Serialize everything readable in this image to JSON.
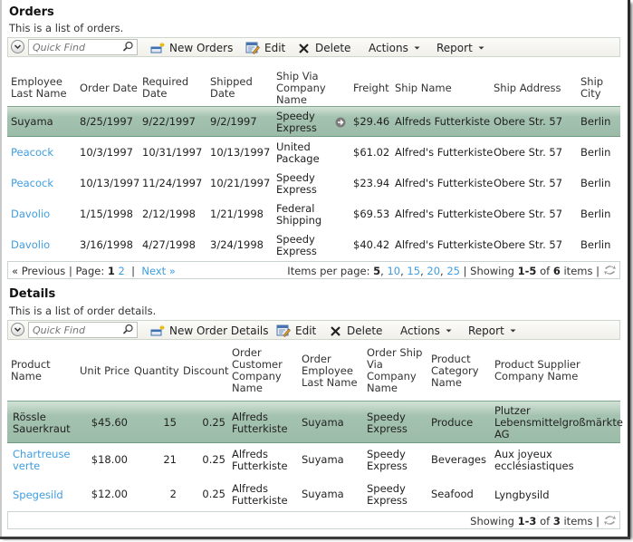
{
  "orders": {
    "title": "Orders",
    "description": "This is a list of orders.",
    "toolbar": {
      "quick_find_placeholder": "Quick Find",
      "new_label": "New Orders",
      "edit_label": "Edit",
      "delete_label": "Delete",
      "actions_label": "Actions",
      "report_label": "Report"
    },
    "columns": [
      [
        "Employee",
        "Last Name"
      ],
      [
        "Order Date"
      ],
      [
        "Required",
        "Date"
      ],
      [
        "Shipped",
        "Date"
      ],
      [
        "Ship Via",
        "Company",
        "Name"
      ],
      [
        "Freight"
      ],
      [
        "Ship Name"
      ],
      [
        "Ship Address"
      ],
      [
        "Ship",
        "City"
      ]
    ],
    "rows": [
      {
        "employee": "Suyama",
        "order_date": "8/25/1997",
        "required_date": "9/22/1997",
        "shipped_date": "9/2/1997",
        "ship_via": [
          "Speedy",
          "Express"
        ],
        "freight": "$29.46",
        "ship_name": "Alfreds Futterkiste",
        "ship_address": "Obere Str. 57",
        "ship_city": "Berlin",
        "selected": true
      },
      {
        "employee": "Peacock",
        "order_date": "10/3/1997",
        "required_date": "10/31/1997",
        "shipped_date": "10/13/1997",
        "ship_via": [
          "United",
          "Package"
        ],
        "freight": "$61.02",
        "ship_name": "Alfred's Futterkiste",
        "ship_address": "Obere Str. 57",
        "ship_city": "Berlin"
      },
      {
        "employee": "Peacock",
        "order_date": "10/13/1997",
        "required_date": "11/24/1997",
        "shipped_date": "10/21/1997",
        "ship_via": [
          "Speedy",
          "Express"
        ],
        "freight": "$23.94",
        "ship_name": "Alfred's Futterkiste",
        "ship_address": "Obere Str. 57",
        "ship_city": "Berlin"
      },
      {
        "employee": "Davolio",
        "order_date": "1/15/1998",
        "required_date": "2/12/1998",
        "shipped_date": "1/21/1998",
        "ship_via": [
          "Federal",
          "Shipping"
        ],
        "freight": "$69.53",
        "ship_name": "Alfred's Futterkiste",
        "ship_address": "Obere Str. 57",
        "ship_city": "Berlin"
      },
      {
        "employee": "Davolio",
        "order_date": "3/16/1998",
        "required_date": "4/27/1998",
        "shipped_date": "3/24/1998",
        "ship_via": [
          "Speedy",
          "Express"
        ],
        "freight": "$40.42",
        "ship_name": "Alfred's Futterkiste",
        "ship_address": "Obere Str. 57",
        "ship_city": "Berlin"
      }
    ],
    "pager": {
      "previous": "« Previous",
      "page_label": "| Page:",
      "current_page": "1",
      "other_page": "2",
      "separator": "|",
      "next": "Next »",
      "items_per_page_label": "Items per page:",
      "current_size": "5",
      "sizes": [
        "10",
        "15",
        "20",
        "25"
      ],
      "showing_label": "| Showing",
      "range": "1-5",
      "of_label": "of",
      "total": "6",
      "items_label": "items |"
    }
  },
  "details": {
    "title": "Details",
    "description": "This is a list of order details.",
    "toolbar": {
      "quick_find_placeholder": "Quick Find",
      "new_label": "New Order Details",
      "edit_label": "Edit",
      "delete_label": "Delete",
      "actions_label": "Actions",
      "report_label": "Report"
    },
    "columns": [
      [
        "Product",
        "Name"
      ],
      [
        "Unit Price"
      ],
      [
        "Quantity"
      ],
      [
        "Discount"
      ],
      [
        "Order",
        "Customer",
        "Company",
        "Name"
      ],
      [
        "Order",
        "Employee",
        "Last Name"
      ],
      [
        "Order Ship",
        "Via",
        "Company",
        "Name"
      ],
      [
        "Product",
        "Category",
        "Name"
      ],
      [
        "Product Supplier",
        "Company Name"
      ]
    ],
    "rows": [
      {
        "product": [
          "Rössle",
          "Sauerkraut"
        ],
        "unit_price": "$45.60",
        "quantity": "15",
        "discount": "0.25",
        "customer": [
          "Alfreds",
          "Futterkiste"
        ],
        "employee": "Suyama",
        "ship_via": [
          "Speedy",
          "Express"
        ],
        "category": "Produce",
        "supplier": [
          "Plutzer",
          "Lebensmittelgroßmärkte",
          "AG"
        ],
        "selected": true
      },
      {
        "product": [
          "Chartreuse",
          "verte"
        ],
        "unit_price": "$18.00",
        "quantity": "21",
        "discount": "0.25",
        "customer": [
          "Alfreds",
          "Futterkiste"
        ],
        "employee": "Suyama",
        "ship_via": [
          "Speedy",
          "Express"
        ],
        "category": "Beverages",
        "supplier": [
          "Aux joyeux",
          "ecclésiastiques"
        ]
      },
      {
        "product": [
          "Spegesild"
        ],
        "unit_price": "$12.00",
        "quantity": "2",
        "discount": "0.25",
        "customer": [
          "Alfreds",
          "Futterkiste"
        ],
        "employee": "Suyama",
        "ship_via": [
          "Speedy",
          "Express"
        ],
        "category": "Seafood",
        "supplier": [
          "Lyngbysild"
        ]
      }
    ],
    "pager": {
      "showing_label": "Showing",
      "range": "1-3",
      "of_label": "of",
      "total": "3",
      "items_label": "items |"
    }
  },
  "colors": {
    "link": "#3f9ee0",
    "selected_row": "#9bbca8",
    "toolbar_bg": "#f1f0ea"
  }
}
